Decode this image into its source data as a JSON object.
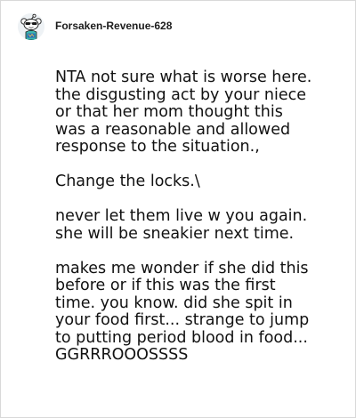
{
  "comment": {
    "author": "Forsaken-Revenue-628",
    "avatar_icon": "snoo-avatar-icon",
    "paragraphs": [
      "NTA not sure what is worse here.\nthe disgusting act by your niece\nor that her mom thought this\nwas a reasonable and allowed\nresponse to the situation.,",
      "Change the locks.\\",
      "never let them live w you again.\nshe will be sneakier next time.",
      "makes me wonder if she did this\nbefore or if this was the first\ntime. you know. did she spit in\nyour food first... strange to jump\nto putting period blood in food...\nGGRRROOOSSSS"
    ]
  }
}
